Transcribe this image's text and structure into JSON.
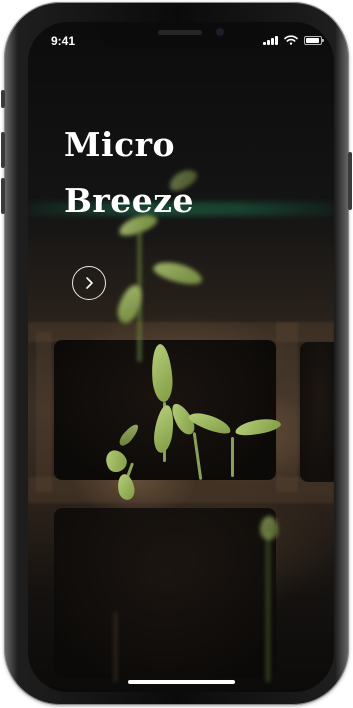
{
  "status_bar": {
    "time": "9:41",
    "icons": [
      "cellular-signal-icon",
      "wifi-icon",
      "battery-icon"
    ]
  },
  "hero": {
    "title_line1": "Micro",
    "title_line2": "Breeze"
  },
  "next_button": {
    "icon": "chevron-right-icon"
  },
  "colors": {
    "title_text": "#ffffff",
    "background": "#0d0c0a",
    "leaf_green": "#9bb65d",
    "soil_brown": "#3c3026"
  }
}
